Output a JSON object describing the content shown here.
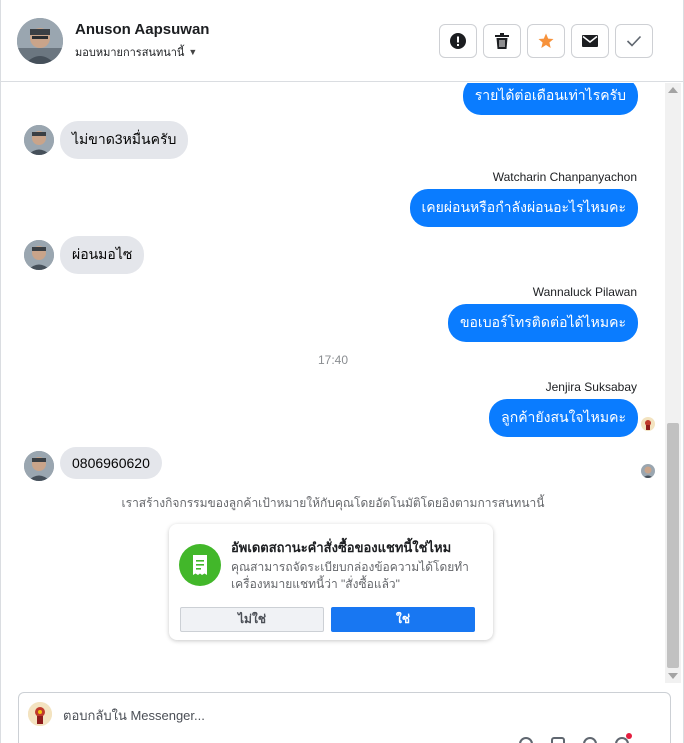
{
  "header": {
    "name": "Anuson Aapsuwan",
    "subtitle": "มอบหมายการสนทนานี้",
    "actions": [
      {
        "icon": "alert-icon",
        "label": "spam"
      },
      {
        "icon": "trash-icon",
        "label": "delete"
      },
      {
        "icon": "star-icon",
        "label": "follow up"
      },
      {
        "icon": "envelope-icon",
        "label": "mark unread"
      },
      {
        "icon": "check-icon",
        "label": "mark done"
      }
    ]
  },
  "colors": {
    "outgoing_bubble": "#0a7cff",
    "incoming_bubble": "#e4e6eb",
    "star": "#f7923b",
    "card_icon": "#42b72a",
    "primary_button": "#1877f2"
  },
  "messages": {
    "m1": "รายได้ต่อเดือนเท่าไรครับ",
    "m2": "ไม่ขาด3หมื่นครับ",
    "m3_sender": "Watcharin Chanpanyachon",
    "m3": "เคยผ่อนหรือกำลังผ่อนอะไรไหมคะ",
    "m4": "ผ่อนมอไซ",
    "m5_sender": "Wannaluck Pilawan",
    "m5": "ขอเบอร์โทรติดต่อได้ไหมคะ",
    "time": "17:40",
    "m6_sender": "Jenjira Suksabay",
    "m6": "ลูกค้ายังสนใจไหมคะ",
    "m7": "0806960620"
  },
  "notice": "เราสร้างกิจกรรมของลูกค้าเป้าหมายให้กับคุณโดยอัตโนมัติโดยอิงตามการสนทนานี้",
  "card": {
    "title": "อัพเดตสถานะคำสั่งซื้อของแชทนี้ใช่ไหม",
    "body": "คุณสามารถจัดระเบียบกล่องข้อความได้โดยทำเครื่องหมายแชทนี้ว่า \"สั่งซื้อแล้ว\"",
    "no_label": "ไม่ใช่",
    "yes_label": "ใช่"
  },
  "composer": {
    "placeholder": "ตอบกลับใน Messenger..."
  }
}
